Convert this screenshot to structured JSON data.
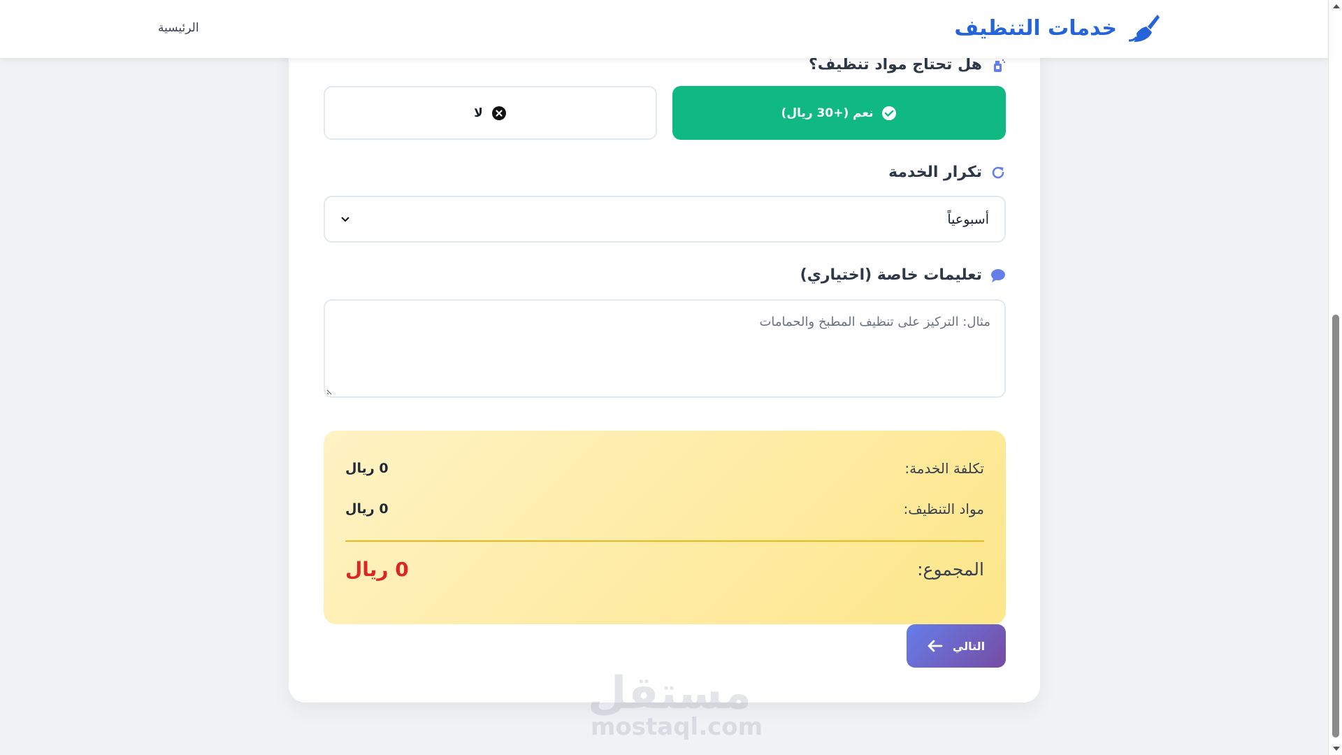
{
  "header": {
    "brand_title": "خدمات التنظيف",
    "nav_home": "الرئيسية"
  },
  "form": {
    "materials": {
      "label": "هل تحتاج مواد تنظيف؟",
      "yes_label": "نعم (+30 ريال)",
      "no_label": "لا",
      "selected": "yes"
    },
    "frequency": {
      "label": "تكرار الخدمة",
      "value": "أسبوعياً"
    },
    "instructions": {
      "label": "تعليمات خاصة (اختياري)",
      "placeholder": "مثال: التركيز على تنظيف المطبخ والحمامات"
    }
  },
  "summary": {
    "service_cost_label": "تكلفة الخدمة:",
    "service_cost_value": "0 ريال",
    "materials_label": "مواد التنظيف:",
    "materials_value": "0 ريال",
    "total_label": "المجموع:",
    "total_value": "0 ريال"
  },
  "actions": {
    "next_label": "التالي"
  },
  "watermark": {
    "arabic": "مستقل",
    "latin": "mostaql.com"
  },
  "colors": {
    "brand": "#2563d9",
    "accent_green": "#10b981",
    "total_red": "#dc2626",
    "button_gradient_start": "#667eea",
    "button_gradient_end": "#764ba2",
    "summary_bg": "#fde68a"
  }
}
